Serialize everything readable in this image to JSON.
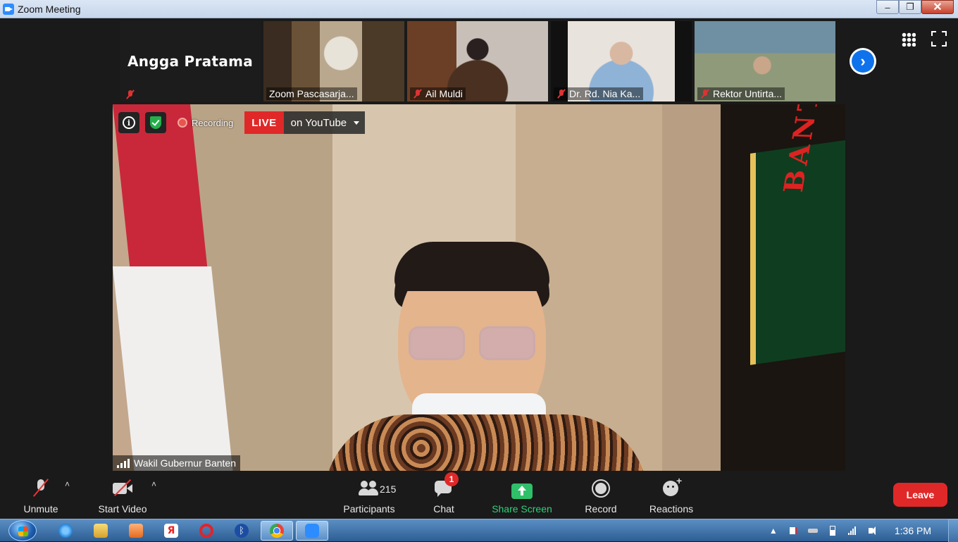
{
  "window": {
    "title": "Zoom Meeting",
    "controls": {
      "minimize": "–",
      "restore": "❐",
      "close": "✕"
    }
  },
  "participant_strip": {
    "tiles": [
      {
        "name": "Angga Pratama",
        "muted": true,
        "video": false
      },
      {
        "name": "Zoom Pascasarja...",
        "muted": false,
        "video": true
      },
      {
        "name": "Ail Muldi",
        "muted": true,
        "video": true
      },
      {
        "name": "Dr. Rd. Nia Ka...",
        "muted": true,
        "video": true
      },
      {
        "name": "Rektor Untirta...",
        "muted": true,
        "video": true
      }
    ],
    "next_icon": "chevron-right-icon"
  },
  "view_controls": {
    "gallery_icon": "grid-icon",
    "fullscreen_icon": "fullscreen-icon"
  },
  "main_video": {
    "speaker_name": "Wakil Gubernur Banten",
    "banner_text": "BANTEN",
    "recording_label": "Recording",
    "live_label": "LIVE",
    "live_destination": "on YouTube"
  },
  "toolbar": {
    "unmute": "Unmute",
    "start_video": "Start Video",
    "participants": "Participants",
    "participants_count": "215",
    "chat": "Chat",
    "chat_badge": "1",
    "share_screen": "Share Screen",
    "record": "Record",
    "reactions": "Reactions",
    "leave": "Leave",
    "caret": "˄"
  },
  "taskbar": {
    "apps": [
      "windows-start-icon",
      "internet-explorer-icon",
      "file-explorer-icon",
      "media-player-icon",
      "yandex-browser-icon",
      "opera-browser-icon",
      "bluetooth-icon",
      "chrome-icon",
      "zoom-icon"
    ],
    "tray_arrow": "▲",
    "clock": "1:36 PM"
  },
  "colors": {
    "accent_blue": "#0e72ed",
    "share_green": "#2fd07a",
    "leave_red": "#e02828",
    "live_red": "#e02828"
  }
}
